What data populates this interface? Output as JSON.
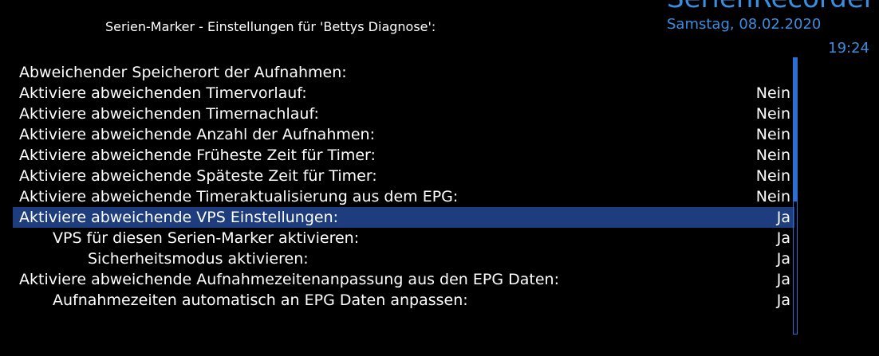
{
  "header": {
    "brand": "SerienRecorder",
    "title": "Serien-Marker - Einstellungen für 'Bettys Diagnose':",
    "date": "Samstag, 08.02.2020",
    "time": "19:24"
  },
  "settings": [
    {
      "label": "Abweichender Speicherort der Aufnahmen:",
      "value": "",
      "indent": 0,
      "selected": false
    },
    {
      "label": "Aktiviere abweichenden Timervorlauf:",
      "value": "Nein",
      "indent": 0,
      "selected": false
    },
    {
      "label": "Aktiviere abweichenden Timernachlauf:",
      "value": "Nein",
      "indent": 0,
      "selected": false
    },
    {
      "label": "Aktiviere abweichende Anzahl der Aufnahmen:",
      "value": "Nein",
      "indent": 0,
      "selected": false
    },
    {
      "label": "Aktiviere abweichende Früheste Zeit für Timer:",
      "value": "Nein",
      "indent": 0,
      "selected": false
    },
    {
      "label": "Aktiviere abweichende Späteste Zeit für Timer:",
      "value": "Nein",
      "indent": 0,
      "selected": false
    },
    {
      "label": "Aktiviere abweichende Timeraktualisierung aus dem EPG:",
      "value": "Nein",
      "indent": 0,
      "selected": false
    },
    {
      "label": "Aktiviere abweichende VPS Einstellungen:",
      "value": "Ja",
      "indent": 0,
      "selected": true
    },
    {
      "label": "VPS für diesen Serien-Marker aktivieren:",
      "value": "Ja",
      "indent": 1,
      "selected": false
    },
    {
      "label": "Sicherheitsmodus aktivieren:",
      "value": "Ja",
      "indent": 2,
      "selected": false
    },
    {
      "label": "Aktiviere abweichende Aufnahmezeitenanpassung aus den EPG Daten:",
      "value": "Ja",
      "indent": 0,
      "selected": false
    },
    {
      "label": "Aufnahmezeiten automatisch an EPG Daten anpassen:",
      "value": "Ja",
      "indent": 1,
      "selected": false
    }
  ],
  "scroll": {
    "position": 0,
    "visible_fraction": 0.52
  },
  "colors": {
    "accent": "#3a8ee0",
    "selection": "#1d3d7e",
    "scrollbar": "#2d6fd0"
  }
}
